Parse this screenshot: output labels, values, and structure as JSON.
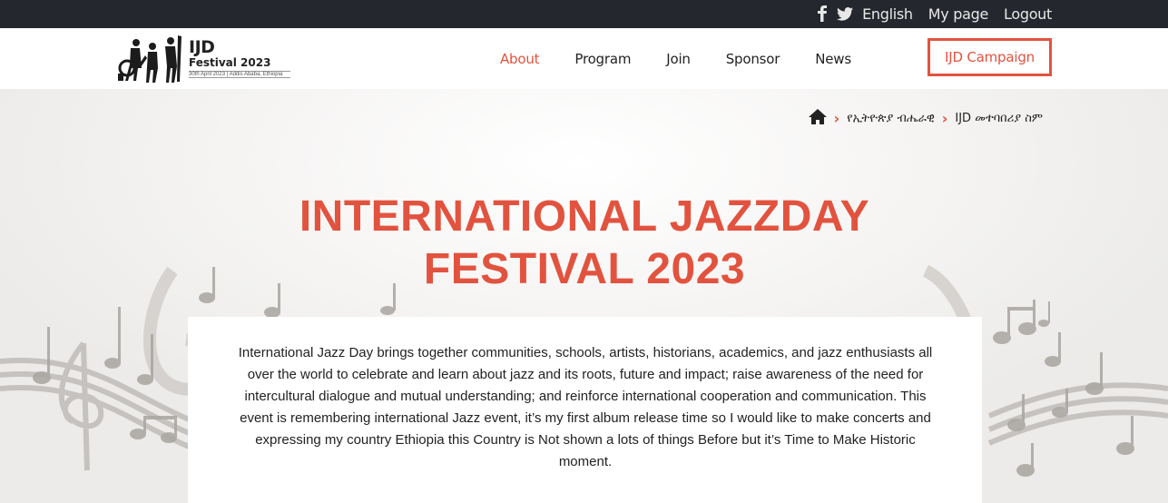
{
  "topbar": {
    "social_icons": [
      "facebook-icon",
      "twitter-icon"
    ],
    "language": "English",
    "my_page": "My page",
    "logout": "Logout"
  },
  "logo": {
    "brand": "IJD",
    "festival": "Festival 2023",
    "date": "30th April 2023 | Addis Ababa, Ethiopia"
  },
  "nav": {
    "items": [
      "About",
      "Program",
      "Join",
      "Sponsor",
      "News"
    ],
    "active": "About",
    "campaign": "IJD Campaign"
  },
  "breadcrumb": {
    "home_icon": "home-icon",
    "items": [
      "የኢትዮጵያ ብሔራዊ",
      "IJD መተባበሪያ ስም"
    ]
  },
  "hero": {
    "title_line1": "INTERNATIONAL JAZZDAY",
    "title_line2": "FESTIVAL 2023",
    "body": "International Jazz Day brings together communities, schools, artists, historians, academics, and jazz enthusiasts all over the world to celebrate and learn about jazz and its roots, future and impact; raise awareness of the need for intercultural dialogue and mutual understanding; and reinforce international cooperation and communication. This event is remembering international Jazz event, it’s my first album release time so I would like to make concerts and expressing my country Ethiopia this Country is Not shown a lots of things Before but it’s Time to Make Historic moment."
  },
  "colors": {
    "accent": "#e2533f",
    "topbar": "#24272d",
    "text": "#222222"
  }
}
